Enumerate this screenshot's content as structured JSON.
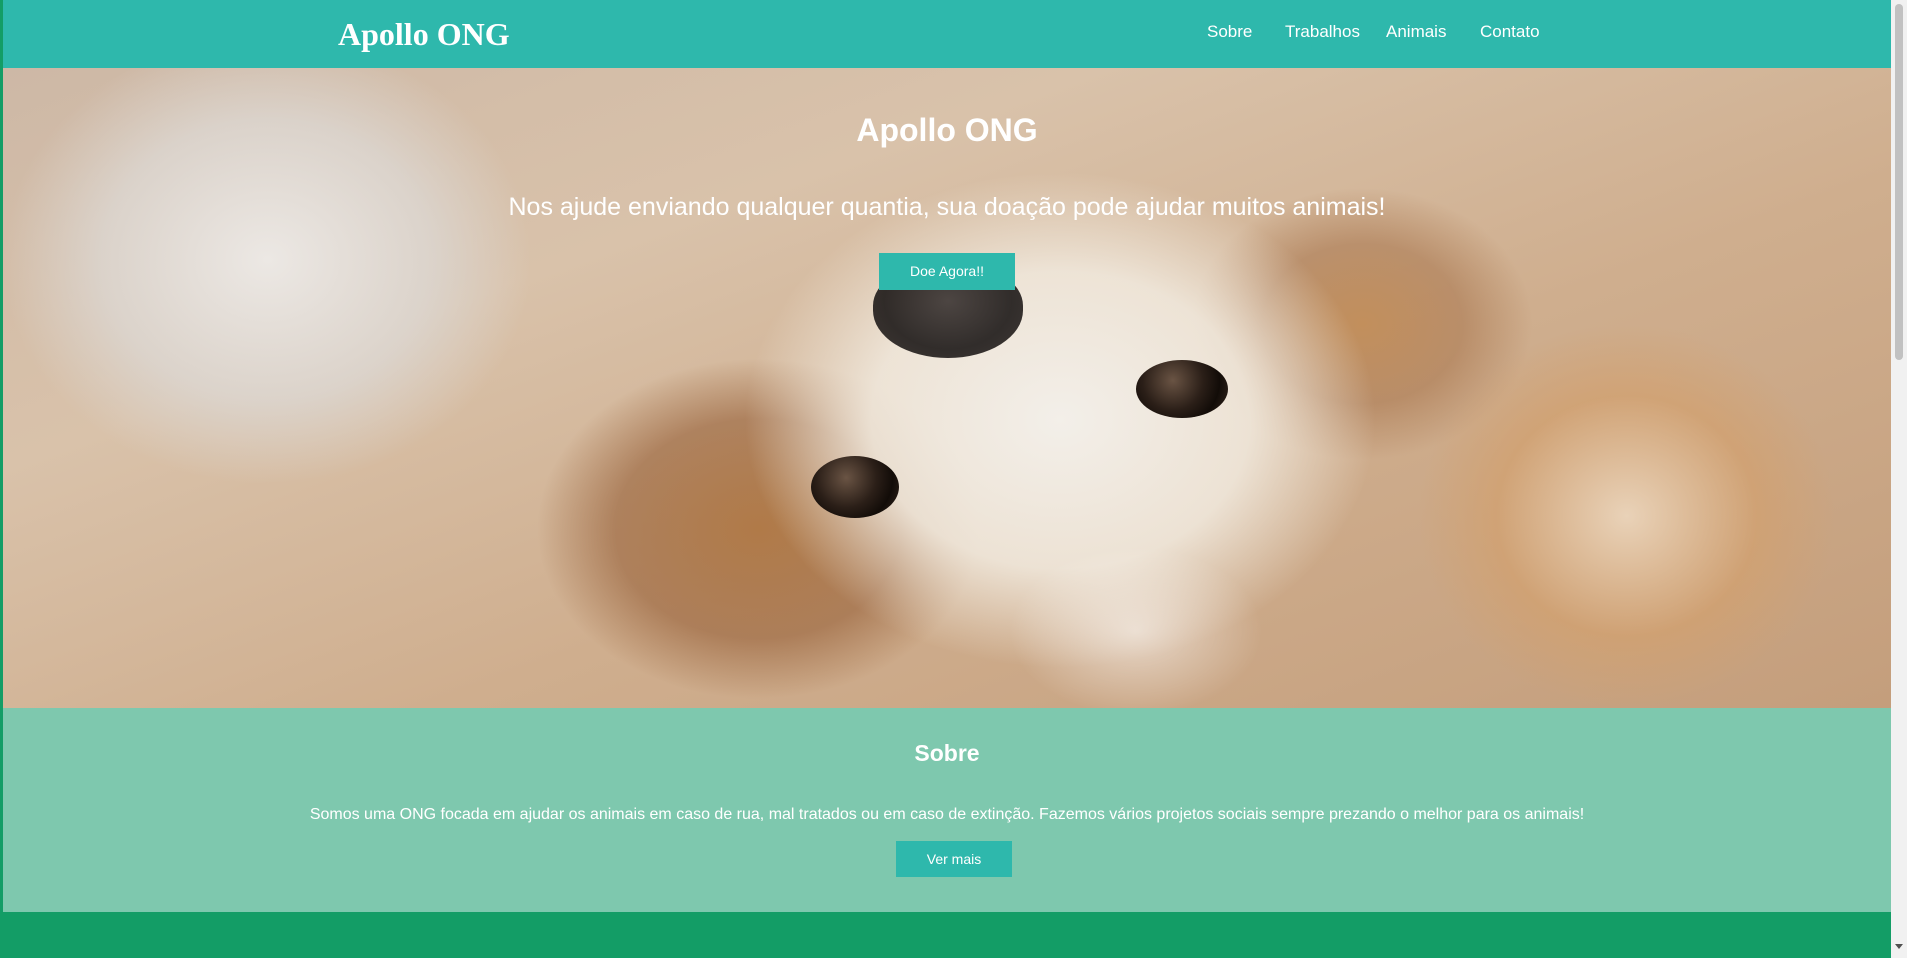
{
  "navbar": {
    "brand": "Apollo ONG",
    "links": [
      "Sobre",
      "Trabalhos",
      "Animais",
      "Contato"
    ]
  },
  "hero": {
    "title": "Apollo ONG",
    "subtitle": "Nos ajude enviando qualquer quantia, sua doação pode ajudar muitos animais!",
    "button_label": "Doe Agora!!"
  },
  "about": {
    "title": "Sobre",
    "text": "Somos uma ONG focada em ajudar os animais em caso de rua, mal tratados ou em caso de extinção. Fazemos vários projetos sociais sempre prezando o melhor para os animais!",
    "button_label": "Ver mais"
  },
  "colors": {
    "navbar": "#2eb8ac",
    "button": "#2eb8ac",
    "about_bg": "#7ec8ae",
    "footer_bg": "#139d66"
  }
}
